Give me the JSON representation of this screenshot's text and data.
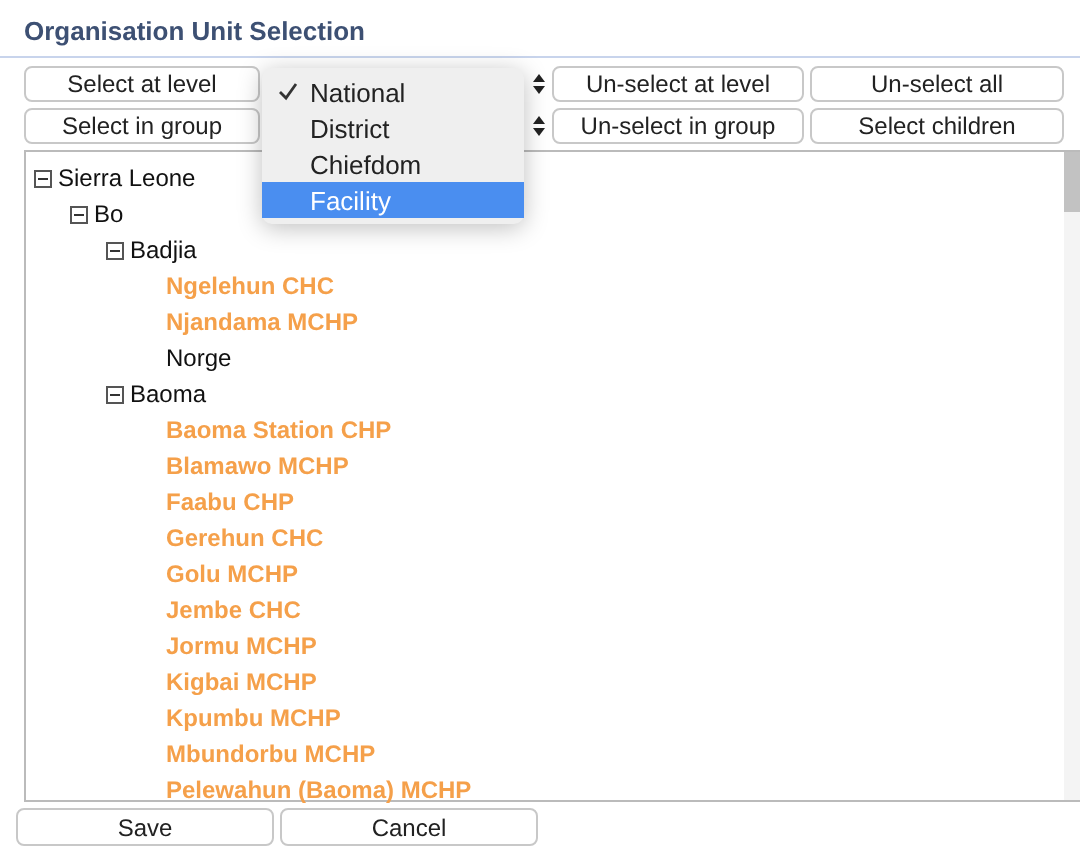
{
  "title": "Organisation Unit Selection",
  "toolbar": [
    [
      {
        "kind": "button",
        "label": "Select at level"
      },
      {
        "kind": "select"
      },
      {
        "kind": "button",
        "label": "Un-select at level"
      },
      {
        "kind": "button",
        "label": "Un-select all"
      }
    ],
    [
      {
        "kind": "button",
        "label": "Select in group"
      },
      {
        "kind": "select"
      },
      {
        "kind": "button",
        "label": "Un-select in group"
      },
      {
        "kind": "button",
        "label": "Select children"
      }
    ]
  ],
  "level_menu": [
    {
      "label": "National",
      "selected": true,
      "highlighted": false
    },
    {
      "label": "District",
      "selected": false,
      "highlighted": false
    },
    {
      "label": "Chiefdom",
      "selected": false,
      "highlighted": false
    },
    {
      "label": "Facility",
      "selected": false,
      "highlighted": true
    }
  ],
  "tree": [
    {
      "name": "Sierra Leone",
      "selected": false,
      "expanded": true,
      "children": [
        {
          "name": "Bo",
          "selected": false,
          "expanded": true,
          "children": [
            {
              "name": "Badjia",
              "selected": false,
              "expanded": true,
              "children": [
                {
                  "name": "Ngelehun CHC",
                  "selected": true
                },
                {
                  "name": "Njandama MCHP",
                  "selected": true
                },
                {
                  "name": "Norge",
                  "selected": false
                }
              ]
            },
            {
              "name": "Baoma",
              "selected": false,
              "expanded": true,
              "children": [
                {
                  "name": "Baoma Station CHP",
                  "selected": true
                },
                {
                  "name": "Blamawo MCHP",
                  "selected": true
                },
                {
                  "name": "Faabu CHP",
                  "selected": true
                },
                {
                  "name": "Gerehun CHC",
                  "selected": true
                },
                {
                  "name": "Golu MCHP",
                  "selected": true
                },
                {
                  "name": "Jembe CHC",
                  "selected": true
                },
                {
                  "name": "Jormu MCHP",
                  "selected": true
                },
                {
                  "name": "Kigbai MCHP",
                  "selected": true
                },
                {
                  "name": "Kpumbu MCHP",
                  "selected": true
                },
                {
                  "name": "Mbundorbu MCHP",
                  "selected": true
                },
                {
                  "name": "Pelewahun (Baoma) MCHP",
                  "selected": true
                }
              ]
            }
          ]
        }
      ]
    }
  ],
  "actions": [
    "Save",
    "Cancel"
  ]
}
